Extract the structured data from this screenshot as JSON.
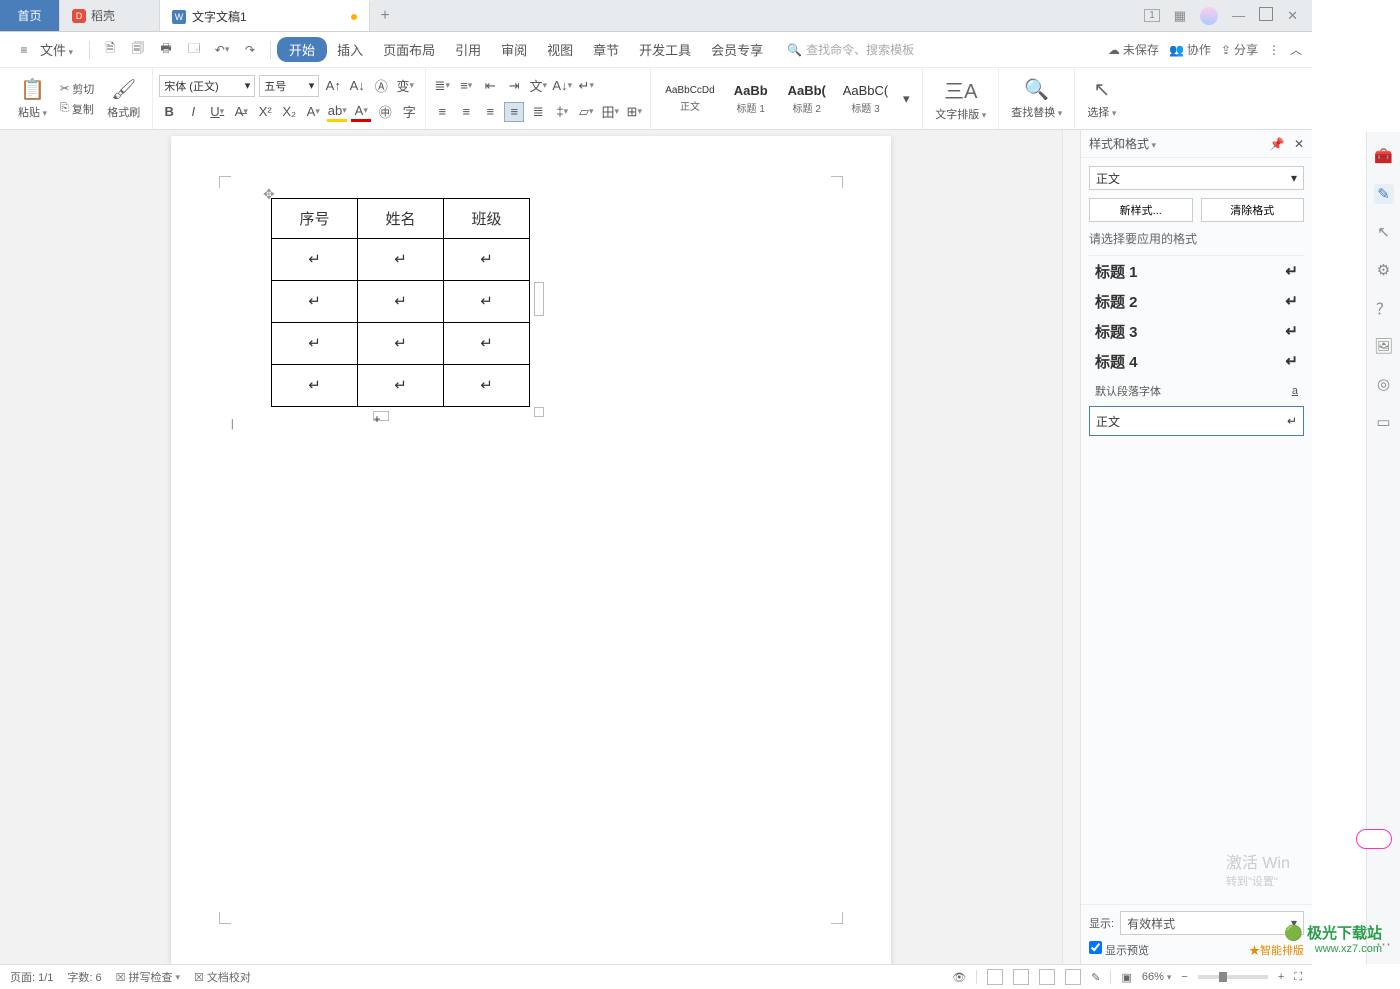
{
  "tabs": {
    "home": "首页",
    "docer": "稻壳",
    "doc": "文字文稿1"
  },
  "window_controls": {
    "pages_indicator": "1"
  },
  "file_menu": "文件",
  "menu": {
    "start": "开始",
    "insert": "插入",
    "layout": "页面布局",
    "reference": "引用",
    "review": "审阅",
    "view": "视图",
    "section": "章节",
    "devtools": "开发工具",
    "member": "会员专享"
  },
  "search_placeholder": "查找命令、搜索模板",
  "top_right": {
    "unsaved": "未保存",
    "coop": "协作",
    "share": "分享"
  },
  "clipboard": {
    "paste": "粘贴",
    "cut": "剪切",
    "copy": "复制",
    "format_painter": "格式刷"
  },
  "font": {
    "name": "宋体 (正文)",
    "size": "五号"
  },
  "styles_gallery": {
    "body_prev": "AaBbCcDd",
    "body_lbl": "正文",
    "h1_prev": "AaBb",
    "h1_lbl": "标题 1",
    "h2_prev": "AaBb(",
    "h2_lbl": "标题 2",
    "h3_prev": "AaBbC(",
    "h3_lbl": "标题 3"
  },
  "biggroups": {
    "text_layout": "文字排版",
    "find_replace": "查找替换",
    "select": "选择"
  },
  "table": {
    "headers": [
      "序号",
      "姓名",
      "班级"
    ],
    "rows": 4
  },
  "sidepanel": {
    "title": "样式和格式",
    "current_style": "正文",
    "new_style": "新样式...",
    "clear_format": "清除格式",
    "choose_label": "请选择要应用的格式",
    "items": [
      "标题 1",
      "标题 2",
      "标题 3",
      "标题 4"
    ],
    "default_font": "默认段落字体",
    "body": "正文",
    "show_label": "显示:",
    "show_value": "有效样式",
    "preview_checkbox": "显示预览",
    "smart_layout": "智能排版"
  },
  "watermark": {
    "line1": "激活 Win",
    "line2": "转到\"设置\""
  },
  "statusbar": {
    "page": "页面: 1/1",
    "words": "字数: 6",
    "spell": "拼写检查",
    "proof": "文档校对",
    "zoom": "66%"
  },
  "logo": {
    "name": "极光下载站",
    "url": "www.xz7.com"
  }
}
